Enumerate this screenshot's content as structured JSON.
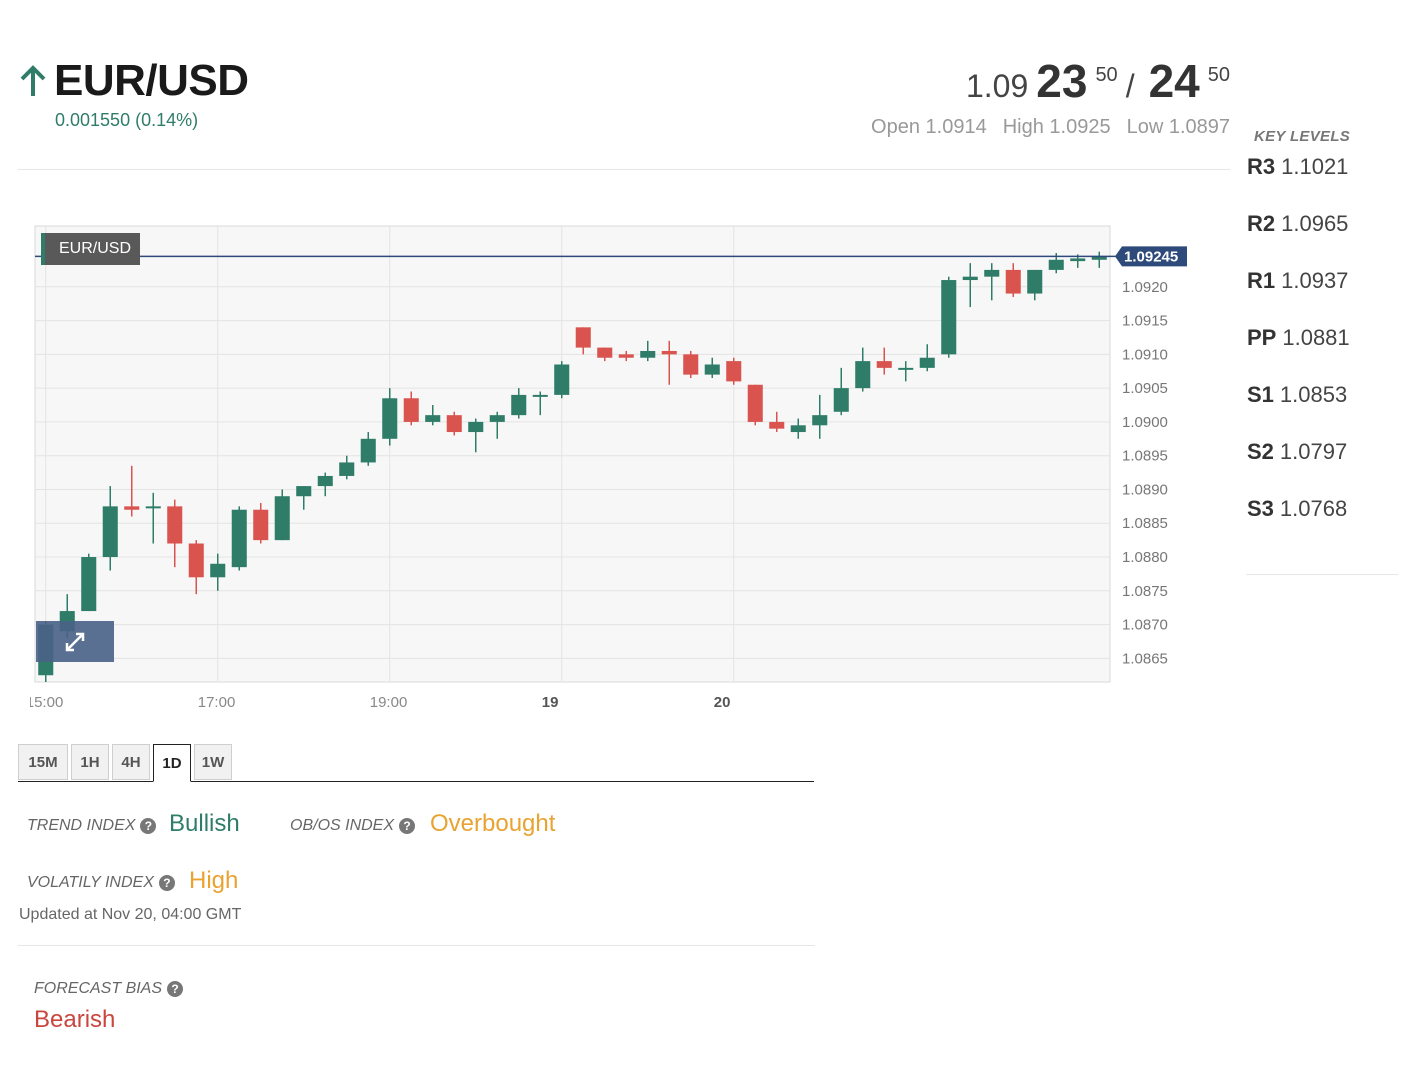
{
  "instrument": {
    "title": "EUR/USD",
    "change": "0.001550 (0.14%)"
  },
  "quote": {
    "bid_prefix": "1.09",
    "bid_big": "23",
    "bid_sup": "50",
    "separator": "/",
    "ask_big": "24",
    "ask_sup": "50"
  },
  "ohl": {
    "open": "Open 1.0914",
    "high": "High 1.0925",
    "low": "Low 1.0897"
  },
  "key_levels": {
    "title": "KEY LEVELS",
    "levels": [
      {
        "name": "R3",
        "value": "1.1021"
      },
      {
        "name": "R2",
        "value": "1.0965"
      },
      {
        "name": "R1",
        "value": "1.0937"
      },
      {
        "name": "PP",
        "value": "1.0881"
      },
      {
        "name": "S1",
        "value": "1.0853"
      },
      {
        "name": "S2",
        "value": "1.0797"
      },
      {
        "name": "S3",
        "value": "1.0768"
      }
    ]
  },
  "chart_data": {
    "type": "candlestick",
    "label": "EUR/USD",
    "current_price": 1.09245,
    "current_price_label": "1.09245",
    "ylim": [
      1.08615,
      1.0929
    ],
    "y_ticks": [
      "1.0920",
      "1.0915",
      "1.0910",
      "1.0905",
      "1.0900",
      "1.0895",
      "1.0890",
      "1.0885",
      "1.0880",
      "1.0875",
      "1.0870",
      "1.0865"
    ],
    "x_ticks": [
      {
        "label": "15:00",
        "index": 0.5,
        "bold": false
      },
      {
        "label": "17:00",
        "index": 8.5,
        "bold": false
      },
      {
        "label": "19:00",
        "index": 16.5,
        "bold": false
      },
      {
        "label": "19",
        "index": 24.5,
        "bold": true
      },
      {
        "label": "20",
        "index": 32.5,
        "bold": true
      }
    ],
    "grid": true,
    "colors": {
      "up": "#2f7d69",
      "down": "#d9534f"
    },
    "candles": [
      {
        "o": 1.08625,
        "h": 1.08705,
        "l": 1.08615,
        "c": 1.087
      },
      {
        "o": 1.0869,
        "h": 1.08745,
        "l": 1.0868,
        "c": 1.0872
      },
      {
        "o": 1.0872,
        "h": 1.08805,
        "l": 1.0872,
        "c": 1.088
      },
      {
        "o": 1.088,
        "h": 1.08905,
        "l": 1.0878,
        "c": 1.08875
      },
      {
        "o": 1.08875,
        "h": 1.08935,
        "l": 1.0886,
        "c": 1.0887
      },
      {
        "o": 1.08875,
        "h": 1.08895,
        "l": 1.0882,
        "c": 1.08875
      },
      {
        "o": 1.08875,
        "h": 1.08885,
        "l": 1.08785,
        "c": 1.0882
      },
      {
        "o": 1.0882,
        "h": 1.08825,
        "l": 1.08745,
        "c": 1.0877
      },
      {
        "o": 1.0877,
        "h": 1.08805,
        "l": 1.0875,
        "c": 1.0879
      },
      {
        "o": 1.08785,
        "h": 1.08875,
        "l": 1.0878,
        "c": 1.0887
      },
      {
        "o": 1.0887,
        "h": 1.0888,
        "l": 1.0882,
        "c": 1.08825
      },
      {
        "o": 1.08825,
        "h": 1.089,
        "l": 1.08825,
        "c": 1.0889
      },
      {
        "o": 1.0889,
        "h": 1.08905,
        "l": 1.0887,
        "c": 1.08905
      },
      {
        "o": 1.08905,
        "h": 1.08925,
        "l": 1.0889,
        "c": 1.0892
      },
      {
        "o": 1.0892,
        "h": 1.0895,
        "l": 1.08915,
        "c": 1.0894
      },
      {
        "o": 1.0894,
        "h": 1.08985,
        "l": 1.08935,
        "c": 1.08975
      },
      {
        "o": 1.08975,
        "h": 1.0905,
        "l": 1.08965,
        "c": 1.09035
      },
      {
        "o": 1.09035,
        "h": 1.09045,
        "l": 1.08995,
        "c": 1.09
      },
      {
        "o": 1.09,
        "h": 1.09025,
        "l": 1.08995,
        "c": 1.0901
      },
      {
        "o": 1.0901,
        "h": 1.09015,
        "l": 1.0898,
        "c": 1.08985
      },
      {
        "o": 1.08985,
        "h": 1.09005,
        "l": 1.08955,
        "c": 1.09
      },
      {
        "o": 1.09,
        "h": 1.09015,
        "l": 1.08975,
        "c": 1.0901
      },
      {
        "o": 1.0901,
        "h": 1.0905,
        "l": 1.09005,
        "c": 1.0904
      },
      {
        "o": 1.0904,
        "h": 1.09045,
        "l": 1.0901,
        "c": 1.0904
      },
      {
        "o": 1.0904,
        "h": 1.0909,
        "l": 1.09035,
        "c": 1.09085
      },
      {
        "o": 1.0914,
        "h": 1.0914,
        "l": 1.091,
        "c": 1.0911
      },
      {
        "o": 1.0911,
        "h": 1.0911,
        "l": 1.0909,
        "c": 1.09095
      },
      {
        "o": 1.091,
        "h": 1.09105,
        "l": 1.0909,
        "c": 1.09095
      },
      {
        "o": 1.09095,
        "h": 1.0912,
        "l": 1.0909,
        "c": 1.09105
      },
      {
        "o": 1.09105,
        "h": 1.0912,
        "l": 1.09055,
        "c": 1.091
      },
      {
        "o": 1.091,
        "h": 1.09105,
        "l": 1.09065,
        "c": 1.0907
      },
      {
        "o": 1.0907,
        "h": 1.09095,
        "l": 1.09065,
        "c": 1.09085
      },
      {
        "o": 1.0909,
        "h": 1.09095,
        "l": 1.09055,
        "c": 1.0906
      },
      {
        "o": 1.09055,
        "h": 1.09055,
        "l": 1.08995,
        "c": 1.09
      },
      {
        "o": 1.09,
        "h": 1.09015,
        "l": 1.08985,
        "c": 1.0899
      },
      {
        "o": 1.08985,
        "h": 1.09005,
        "l": 1.08975,
        "c": 1.08995
      },
      {
        "o": 1.08995,
        "h": 1.0904,
        "l": 1.08975,
        "c": 1.0901
      },
      {
        "o": 1.09015,
        "h": 1.0908,
        "l": 1.0901,
        "c": 1.0905
      },
      {
        "o": 1.0905,
        "h": 1.0911,
        "l": 1.09045,
        "c": 1.0909
      },
      {
        "o": 1.0909,
        "h": 1.0911,
        "l": 1.0907,
        "c": 1.0908
      },
      {
        "o": 1.0908,
        "h": 1.0909,
        "l": 1.0906,
        "c": 1.0908
      },
      {
        "o": 1.0908,
        "h": 1.09115,
        "l": 1.09075,
        "c": 1.09095
      },
      {
        "o": 1.091,
        "h": 1.09215,
        "l": 1.09095,
        "c": 1.0921
      },
      {
        "o": 1.0921,
        "h": 1.09235,
        "l": 1.0917,
        "c": 1.09215
      },
      {
        "o": 1.09215,
        "h": 1.09235,
        "l": 1.0918,
        "c": 1.09225
      },
      {
        "o": 1.09225,
        "h": 1.09235,
        "l": 1.09185,
        "c": 1.0919
      },
      {
        "o": 1.0919,
        "h": 1.09225,
        "l": 1.0918,
        "c": 1.09225
      },
      {
        "o": 1.09225,
        "h": 1.0925,
        "l": 1.0922,
        "c": 1.0924
      },
      {
        "o": 1.09238,
        "h": 1.09248,
        "l": 1.09228,
        "c": 1.09242
      },
      {
        "o": 1.0924,
        "h": 1.09252,
        "l": 1.09228,
        "c": 1.09245
      }
    ]
  },
  "tabs": [
    {
      "label": "15M",
      "active": false
    },
    {
      "label": "1H",
      "active": false
    },
    {
      "label": "4H",
      "active": false
    },
    {
      "label": "1D",
      "active": true
    },
    {
      "label": "1W",
      "active": false
    }
  ],
  "indices": {
    "trend_label": "TREND INDEX",
    "trend_value": "Bullish",
    "obos_label": "OB/OS INDEX",
    "obos_value": "Overbought",
    "volatility_label": "VOLATILY INDEX",
    "volatility_value": "High",
    "updated": "Updated at Nov 20, 04:00 GMT",
    "forecast_label": "FORECAST BIAS",
    "forecast_value": "Bearish",
    "help_icon_text": "?"
  },
  "colors": {
    "bullish": "#2f7d69",
    "overbought": "#e8a331",
    "high": "#e8a331",
    "bearish": "#c9463d"
  }
}
